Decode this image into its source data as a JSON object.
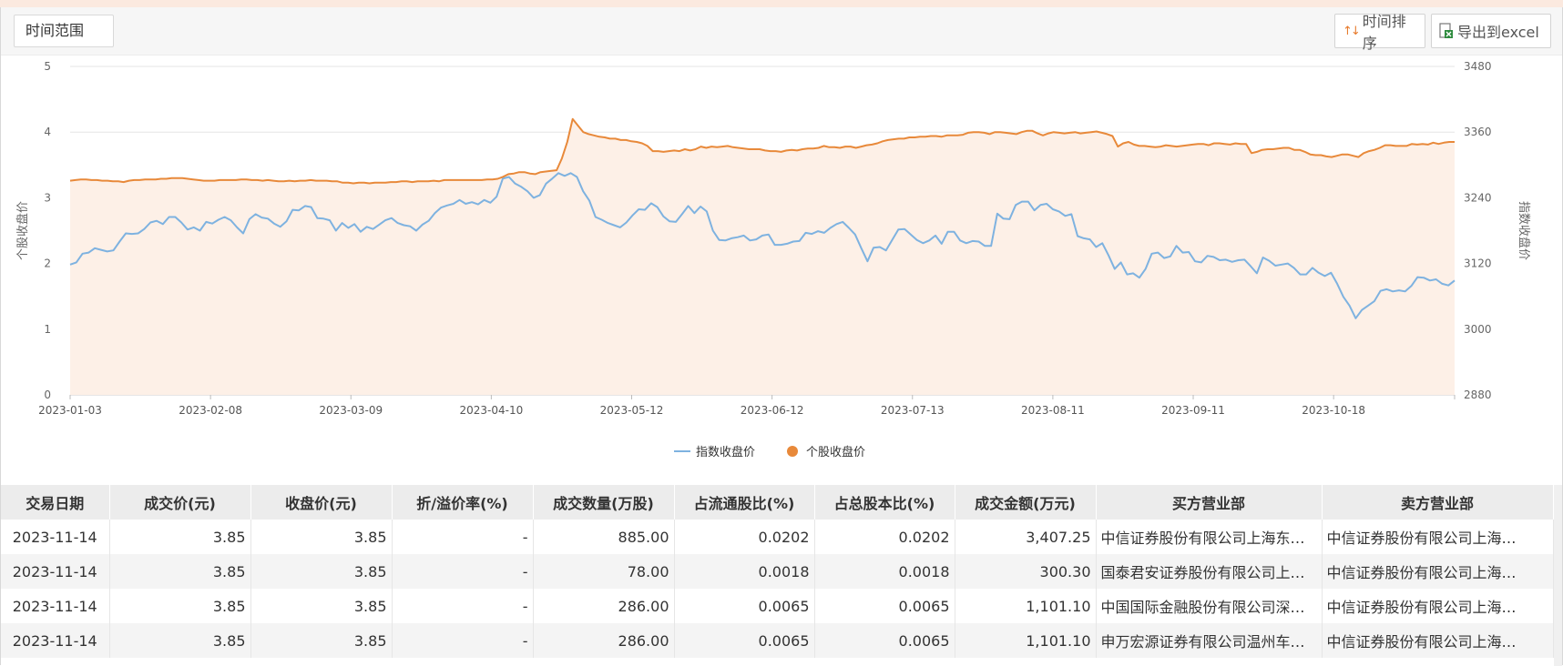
{
  "toolbar": {
    "range_label": "时间范围",
    "sort_label": "时间排序",
    "export_label": "导出到excel"
  },
  "colors": {
    "stock_line": "#e8893a",
    "index_line": "#7eb2e0",
    "area_fill": "#fdf0e7"
  },
  "chart_data": {
    "type": "line",
    "x_tick_labels": [
      "2023-01-03",
      "2023-02-08",
      "2023-03-09",
      "2023-04-10",
      "2023-05-12",
      "2023-06-12",
      "2023-07-13",
      "2023-08-11",
      "2023-09-11",
      "2023-10-18"
    ],
    "left_axis": {
      "label": "个股收盘价",
      "ylim": [
        0,
        5
      ],
      "ticks": [
        0,
        1,
        2,
        3,
        4,
        5
      ]
    },
    "right_axis": {
      "label": "指数收盘价",
      "ylim": [
        2880,
        3480
      ],
      "ticks": [
        2880,
        3000,
        3120,
        3240,
        3360,
        3480
      ]
    },
    "legend": {
      "placement": "bottom-center"
    },
    "grid": true,
    "series": [
      {
        "name": "指数收盘价",
        "axis": "right",
        "values": [
          3118,
          3122,
          3138,
          3140,
          3148,
          3145,
          3142,
          3144,
          3160,
          3175,
          3174,
          3175,
          3183,
          3195,
          3198,
          3192,
          3205,
          3205,
          3195,
          3182,
          3186,
          3180,
          3196,
          3193,
          3200,
          3205,
          3199,
          3186,
          3175,
          3201,
          3210,
          3204,
          3202,
          3193,
          3187,
          3197,
          3218,
          3217,
          3225,
          3223,
          3203,
          3202,
          3199,
          3180,
          3194,
          3185,
          3192,
          3178,
          3187,
          3183,
          3191,
          3199,
          3203,
          3194,
          3190,
          3188,
          3180,
          3191,
          3198,
          3212,
          3222,
          3226,
          3229,
          3236,
          3229,
          3232,
          3228,
          3236,
          3231,
          3242,
          3275,
          3278,
          3266,
          3260,
          3252,
          3240,
          3245,
          3266,
          3275,
          3285,
          3280,
          3285,
          3278,
          3252,
          3235,
          3205,
          3200,
          3194,
          3190,
          3186,
          3195,
          3208,
          3219,
          3218,
          3230,
          3223,
          3206,
          3197,
          3196,
          3210,
          3225,
          3212,
          3224,
          3215,
          3180,
          3163,
          3162,
          3166,
          3168,
          3171,
          3162,
          3164,
          3171,
          3173,
          3154,
          3154,
          3156,
          3160,
          3161,
          3176,
          3174,
          3179,
          3176,
          3185,
          3192,
          3196,
          3185,
          3173,
          3148,
          3124,
          3149,
          3150,
          3144,
          3163,
          3182,
          3183,
          3173,
          3163,
          3157,
          3162,
          3171,
          3156,
          3178,
          3178,
          3162,
          3157,
          3161,
          3160,
          3152,
          3152,
          3211,
          3202,
          3201,
          3227,
          3233,
          3233,
          3217,
          3227,
          3229,
          3219,
          3215,
          3207,
          3210,
          3170,
          3166,
          3164,
          3150,
          3157,
          3135,
          3110,
          3122,
          3100,
          3102,
          3094,
          3110,
          3138,
          3140,
          3130,
          3133,
          3152,
          3140,
          3141,
          3124,
          3122,
          3134,
          3132,
          3126,
          3127,
          3123,
          3126,
          3127,
          3115,
          3102,
          3131,
          3125,
          3116,
          3118,
          3120,
          3112,
          3100,
          3100,
          3112,
          3103,
          3097,
          3103,
          3083,
          3059,
          3043,
          3020,
          3035,
          3043,
          3051,
          3070,
          3073,
          3069,
          3071,
          3069,
          3079,
          3095,
          3094,
          3089,
          3091,
          3083,
          3080,
          3089
        ]
      },
      {
        "name": "个股收盘价",
        "axis": "left",
        "values": [
          3.26,
          3.27,
          3.28,
          3.28,
          3.27,
          3.27,
          3.26,
          3.26,
          3.25,
          3.25,
          3.24,
          3.26,
          3.27,
          3.27,
          3.28,
          3.28,
          3.28,
          3.29,
          3.29,
          3.3,
          3.3,
          3.3,
          3.29,
          3.28,
          3.27,
          3.26,
          3.26,
          3.26,
          3.27,
          3.27,
          3.27,
          3.27,
          3.28,
          3.28,
          3.27,
          3.27,
          3.26,
          3.27,
          3.26,
          3.25,
          3.25,
          3.26,
          3.25,
          3.26,
          3.26,
          3.27,
          3.26,
          3.26,
          3.26,
          3.25,
          3.25,
          3.23,
          3.23,
          3.22,
          3.23,
          3.23,
          3.22,
          3.23,
          3.23,
          3.23,
          3.24,
          3.24,
          3.25,
          3.25,
          3.24,
          3.25,
          3.25,
          3.25,
          3.26,
          3.25,
          3.27,
          3.27,
          3.27,
          3.27,
          3.27,
          3.27,
          3.27,
          3.27,
          3.28,
          3.28,
          3.29,
          3.32,
          3.36,
          3.37,
          3.39,
          3.39,
          3.37,
          3.36,
          3.39,
          3.4,
          3.41,
          3.42,
          3.6,
          3.85,
          4.2,
          4.1,
          4.0,
          3.97,
          3.95,
          3.93,
          3.92,
          3.9,
          3.9,
          3.88,
          3.88,
          3.86,
          3.85,
          3.83,
          3.79,
          3.71,
          3.71,
          3.7,
          3.71,
          3.72,
          3.71,
          3.74,
          3.72,
          3.74,
          3.78,
          3.76,
          3.78,
          3.77,
          3.78,
          3.79,
          3.77,
          3.76,
          3.75,
          3.74,
          3.74,
          3.74,
          3.72,
          3.71,
          3.71,
          3.7,
          3.72,
          3.73,
          3.72,
          3.74,
          3.75,
          3.75,
          3.76,
          3.79,
          3.77,
          3.77,
          3.76,
          3.78,
          3.78,
          3.76,
          3.78,
          3.8,
          3.81,
          3.83,
          3.86,
          3.88,
          3.89,
          3.9,
          3.9,
          3.92,
          3.92,
          3.93,
          3.93,
          3.94,
          3.94,
          3.93,
          3.95,
          3.95,
          3.95,
          3.96,
          3.99,
          4.0,
          4.0,
          3.99,
          3.97,
          4.0,
          4.0,
          3.99,
          3.98,
          3.97,
          4.0,
          4.02,
          4.02,
          3.98,
          3.95,
          3.98,
          4.0,
          3.99,
          3.98,
          3.99,
          4.0,
          3.98,
          3.99,
          4.0,
          4.01,
          3.99,
          3.97,
          3.94,
          3.78,
          3.83,
          3.85,
          3.81,
          3.79,
          3.79,
          3.78,
          3.77,
          3.78,
          3.8,
          3.79,
          3.78,
          3.79,
          3.8,
          3.81,
          3.82,
          3.82,
          3.8,
          3.83,
          3.83,
          3.82,
          3.81,
          3.83,
          3.82,
          3.82,
          3.68,
          3.7,
          3.73,
          3.74,
          3.74,
          3.75,
          3.76,
          3.76,
          3.73,
          3.73,
          3.7,
          3.66,
          3.65,
          3.65,
          3.63,
          3.62,
          3.64,
          3.66,
          3.66,
          3.64,
          3.62,
          3.68,
          3.71,
          3.73,
          3.76,
          3.8,
          3.8,
          3.79,
          3.79,
          3.79,
          3.82,
          3.81,
          3.82,
          3.81,
          3.84,
          3.82,
          3.84,
          3.85,
          3.85
        ]
      }
    ]
  },
  "table": {
    "columns": [
      "交易日期",
      "成交价(元)",
      "收盘价(元)",
      "折/溢价率(%)",
      "成交数量(万股)",
      "占流通股比(%)",
      "占总股本比(%)",
      "成交金额(万元)",
      "买方营业部",
      "卖方营业部"
    ],
    "rows": [
      [
        "2023-11-14",
        "3.85",
        "3.85",
        "-",
        "885.00",
        "0.0202",
        "0.0202",
        "3,407.25",
        "中信证券股份有限公司上海东…",
        "中信证券股份有限公司上海…"
      ],
      [
        "2023-11-14",
        "3.85",
        "3.85",
        "-",
        "78.00",
        "0.0018",
        "0.0018",
        "300.30",
        "国泰君安证券股份有限公司上…",
        "中信证券股份有限公司上海…"
      ],
      [
        "2023-11-14",
        "3.85",
        "3.85",
        "-",
        "286.00",
        "0.0065",
        "0.0065",
        "1,101.10",
        "中国国际金融股份有限公司深…",
        "中信证券股份有限公司上海…"
      ],
      [
        "2023-11-14",
        "3.85",
        "3.85",
        "-",
        "286.00",
        "0.0065",
        "0.0065",
        "1,101.10",
        "申万宏源证券有限公司温州车…",
        "中信证券股份有限公司上海…"
      ]
    ]
  }
}
